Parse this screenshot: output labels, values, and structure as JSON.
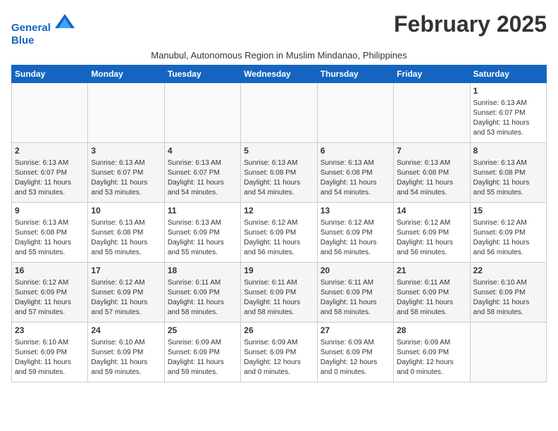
{
  "header": {
    "logo_line1": "General",
    "logo_line2": "Blue",
    "month_title": "February 2025",
    "subtitle": "Manubul, Autonomous Region in Muslim Mindanao, Philippines"
  },
  "days_of_week": [
    "Sunday",
    "Monday",
    "Tuesday",
    "Wednesday",
    "Thursday",
    "Friday",
    "Saturday"
  ],
  "weeks": [
    [
      {
        "num": "",
        "data": ""
      },
      {
        "num": "",
        "data": ""
      },
      {
        "num": "",
        "data": ""
      },
      {
        "num": "",
        "data": ""
      },
      {
        "num": "",
        "data": ""
      },
      {
        "num": "",
        "data": ""
      },
      {
        "num": "1",
        "data": "Sunrise: 6:13 AM\nSunset: 6:07 PM\nDaylight: 11 hours\nand 53 minutes."
      }
    ],
    [
      {
        "num": "2",
        "data": "Sunrise: 6:13 AM\nSunset: 6:07 PM\nDaylight: 11 hours\nand 53 minutes."
      },
      {
        "num": "3",
        "data": "Sunrise: 6:13 AM\nSunset: 6:07 PM\nDaylight: 11 hours\nand 53 minutes."
      },
      {
        "num": "4",
        "data": "Sunrise: 6:13 AM\nSunset: 6:07 PM\nDaylight: 11 hours\nand 54 minutes."
      },
      {
        "num": "5",
        "data": "Sunrise: 6:13 AM\nSunset: 6:08 PM\nDaylight: 11 hours\nand 54 minutes."
      },
      {
        "num": "6",
        "data": "Sunrise: 6:13 AM\nSunset: 6:08 PM\nDaylight: 11 hours\nand 54 minutes."
      },
      {
        "num": "7",
        "data": "Sunrise: 6:13 AM\nSunset: 6:08 PM\nDaylight: 11 hours\nand 54 minutes."
      },
      {
        "num": "8",
        "data": "Sunrise: 6:13 AM\nSunset: 6:08 PM\nDaylight: 11 hours\nand 55 minutes."
      }
    ],
    [
      {
        "num": "9",
        "data": "Sunrise: 6:13 AM\nSunset: 6:08 PM\nDaylight: 11 hours\nand 55 minutes."
      },
      {
        "num": "10",
        "data": "Sunrise: 6:13 AM\nSunset: 6:08 PM\nDaylight: 11 hours\nand 55 minutes."
      },
      {
        "num": "11",
        "data": "Sunrise: 6:13 AM\nSunset: 6:09 PM\nDaylight: 11 hours\nand 55 minutes."
      },
      {
        "num": "12",
        "data": "Sunrise: 6:12 AM\nSunset: 6:09 PM\nDaylight: 11 hours\nand 56 minutes."
      },
      {
        "num": "13",
        "data": "Sunrise: 6:12 AM\nSunset: 6:09 PM\nDaylight: 11 hours\nand 56 minutes."
      },
      {
        "num": "14",
        "data": "Sunrise: 6:12 AM\nSunset: 6:09 PM\nDaylight: 11 hours\nand 56 minutes."
      },
      {
        "num": "15",
        "data": "Sunrise: 6:12 AM\nSunset: 6:09 PM\nDaylight: 11 hours\nand 56 minutes."
      }
    ],
    [
      {
        "num": "16",
        "data": "Sunrise: 6:12 AM\nSunset: 6:09 PM\nDaylight: 11 hours\nand 57 minutes."
      },
      {
        "num": "17",
        "data": "Sunrise: 6:12 AM\nSunset: 6:09 PM\nDaylight: 11 hours\nand 57 minutes."
      },
      {
        "num": "18",
        "data": "Sunrise: 6:11 AM\nSunset: 6:09 PM\nDaylight: 11 hours\nand 58 minutes."
      },
      {
        "num": "19",
        "data": "Sunrise: 6:11 AM\nSunset: 6:09 PM\nDaylight: 11 hours\nand 58 minutes."
      },
      {
        "num": "20",
        "data": "Sunrise: 6:11 AM\nSunset: 6:09 PM\nDaylight: 11 hours\nand 58 minutes."
      },
      {
        "num": "21",
        "data": "Sunrise: 6:11 AM\nSunset: 6:09 PM\nDaylight: 11 hours\nand 58 minutes."
      },
      {
        "num": "22",
        "data": "Sunrise: 6:10 AM\nSunset: 6:09 PM\nDaylight: 11 hours\nand 58 minutes."
      }
    ],
    [
      {
        "num": "23",
        "data": "Sunrise: 6:10 AM\nSunset: 6:09 PM\nDaylight: 11 hours\nand 59 minutes."
      },
      {
        "num": "24",
        "data": "Sunrise: 6:10 AM\nSunset: 6:09 PM\nDaylight: 11 hours\nand 59 minutes."
      },
      {
        "num": "25",
        "data": "Sunrise: 6:09 AM\nSunset: 6:09 PM\nDaylight: 11 hours\nand 59 minutes."
      },
      {
        "num": "26",
        "data": "Sunrise: 6:09 AM\nSunset: 6:09 PM\nDaylight: 12 hours\nand 0 minutes."
      },
      {
        "num": "27",
        "data": "Sunrise: 6:09 AM\nSunset: 6:09 PM\nDaylight: 12 hours\nand 0 minutes."
      },
      {
        "num": "28",
        "data": "Sunrise: 6:09 AM\nSunset: 6:09 PM\nDaylight: 12 hours\nand 0 minutes."
      },
      {
        "num": "",
        "data": ""
      }
    ]
  ]
}
